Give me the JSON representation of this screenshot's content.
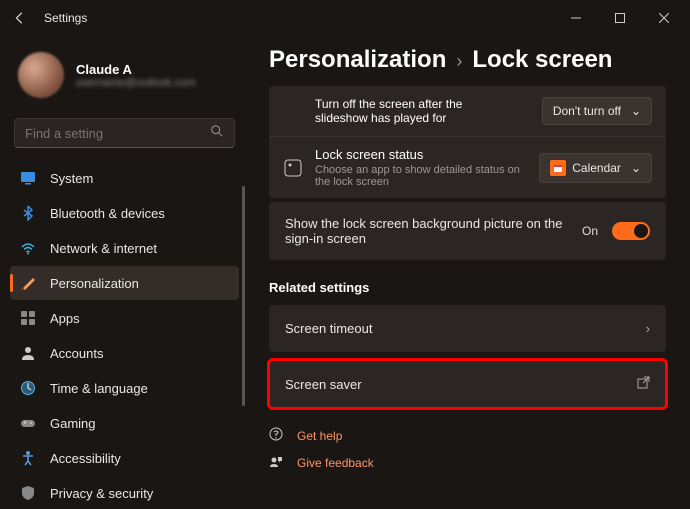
{
  "window": {
    "title": "Settings"
  },
  "user": {
    "name": "Claude A",
    "email": "username@outlook.com"
  },
  "search": {
    "placeholder": "Find a setting"
  },
  "nav": {
    "items": [
      {
        "label": "System"
      },
      {
        "label": "Bluetooth & devices"
      },
      {
        "label": "Network & internet"
      },
      {
        "label": "Personalization"
      },
      {
        "label": "Apps"
      },
      {
        "label": "Accounts"
      },
      {
        "label": "Time & language"
      },
      {
        "label": "Gaming"
      },
      {
        "label": "Accessibility"
      },
      {
        "label": "Privacy & security"
      }
    ]
  },
  "breadcrumb": {
    "parent": "Personalization",
    "current": "Lock screen"
  },
  "slideshow": {
    "title": "Turn off the screen after the slideshow has played for",
    "value": "Don't turn off"
  },
  "status": {
    "title": "Lock screen status",
    "subtitle": "Choose an app to show detailed status on the lock screen",
    "value": "Calendar"
  },
  "signin": {
    "text": "Show the lock screen background picture on the sign-in screen",
    "state": "On"
  },
  "related": {
    "heading": "Related settings",
    "timeout": "Screen timeout",
    "saver": "Screen saver"
  },
  "footer": {
    "help": "Get help",
    "feedback": "Give feedback"
  }
}
